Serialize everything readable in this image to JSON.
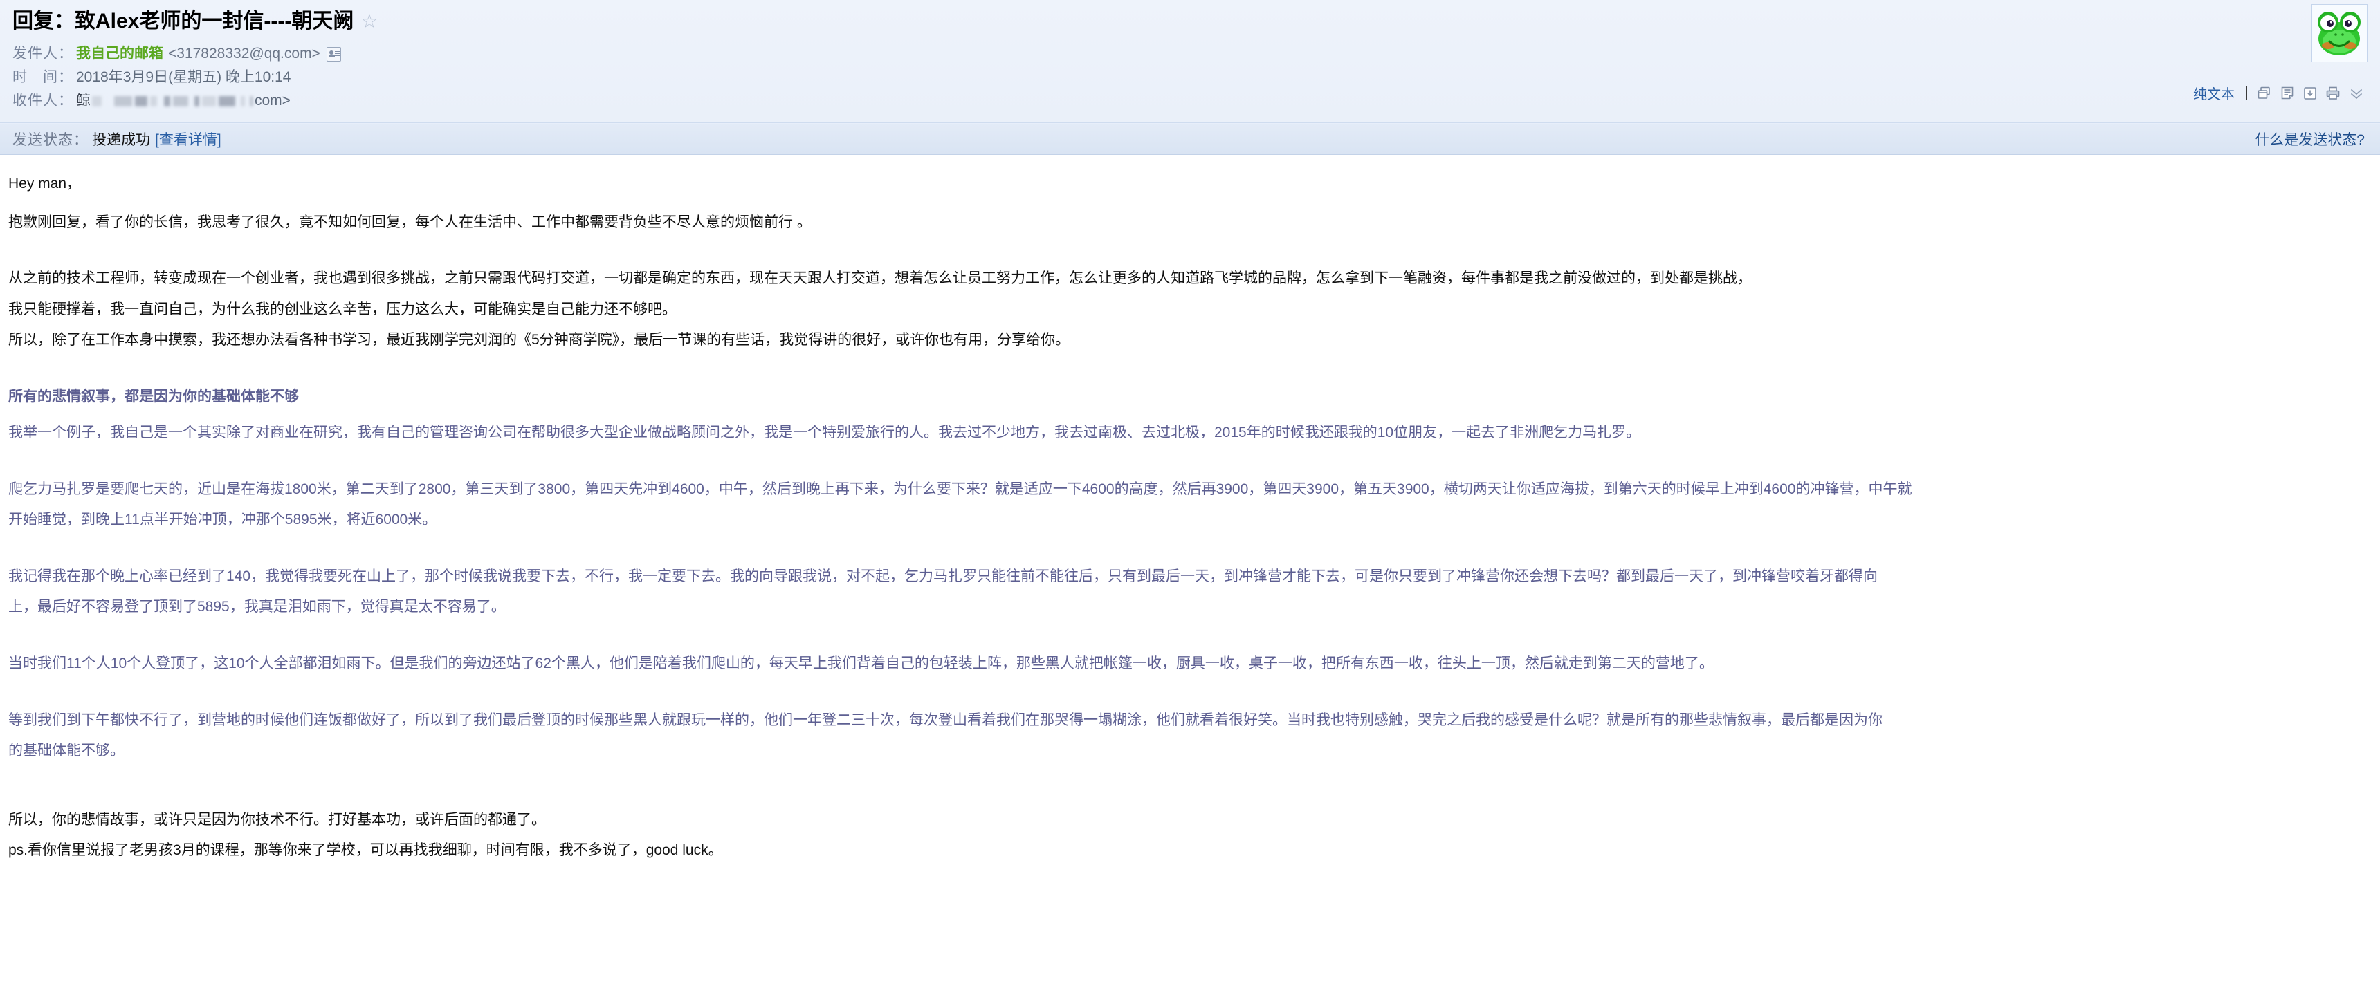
{
  "header": {
    "subject": "回复：致Alex老师的一封信----朝天阙",
    "star_icon": "star-outline-icon",
    "sender_label": "发件人：",
    "sender_name": "我自己的邮箱",
    "sender_address": "<317828332@qq.com>",
    "contact_card_icon": "contact-card-icon",
    "time_label": "时　间：",
    "time_value": "2018年3月9日(星期五) 晚上10:14",
    "recipient_label": "收件人：",
    "recipient_name": "鲸",
    "recipient_address_tail": "com>",
    "avatar_icon": "frog-avatar-icon"
  },
  "toolbar": {
    "plaintext_label": "纯文本",
    "icons": [
      {
        "name": "new-window-icon"
      },
      {
        "name": "note-edit-icon"
      },
      {
        "name": "save-download-icon"
      },
      {
        "name": "print-icon"
      },
      {
        "name": "chevron-double-down-icon"
      }
    ]
  },
  "status": {
    "label": "发送状态：",
    "value": "投递成功",
    "detail_link": "[查看详情]",
    "help_link": "什么是发送状态?"
  },
  "body": {
    "greeting": "Hey man，",
    "p1": "抱歉刚回复，看了你的长信，我思考了很久，竟不知如何回复，每个人在生活中、工作中都需要背负些不尽人意的烦恼前行 。",
    "p2": "从之前的技术工程师，转变成现在一个创业者，我也遇到很多挑战，之前只需跟代码打交道，一切都是确定的东西，现在天天跟人打交道，想着怎么让员工努力工作，怎么让更多的人知道路飞学城的品牌，怎么拿到下一笔融资，每件事都是我之前没做过的，到处都是挑战，",
    "p3": "我只能硬撑着，我一直问自己，为什么我的创业这么辛苦，压力这么大，可能确实是自己能力还不够吧。",
    "p4": "所以，除了在工作本身中摸索，我还想办法看各种书学习，最近我刚学完刘润的《5分钟商学院》，最后一节课的有些话，我觉得讲的很好，或许你也有用，分享给你。",
    "heading": "所有的悲情叙事，都是因为你的基础体能不够",
    "p5": "我举一个例子，我自己是一个其实除了对商业在研究，我有自己的管理咨询公司在帮助很多大型企业做战略顾问之外，我是一个特别爱旅行的人。我去过不少地方，我去过南极、去过北极，2015年的时候我还跟我的10位朋友，一起去了非洲爬乞力马扎罗。",
    "p6": "爬乞力马扎罗是要爬七天的，近山是在海拔1800米，第二天到了2800，第三天到了3800，第四天先冲到4600，中午，然后到晚上再下来，为什么要下来？就是适应一下4600的高度，然后再3900，第四天3900，第五天3900，横切两天让你适应海拔，到第六天的时候早上冲到4600的冲锋营，中午就",
    "p7": "开始睡觉，到晚上11点半开始冲顶，冲那个5895米，将近6000米。",
    "p8": "我记得我在那个晚上心率已经到了140，我觉得我要死在山上了，那个时候我说我要下去，不行，我一定要下去。我的向导跟我说，对不起，乞力马扎罗只能往前不能往后，只有到最后一天，到冲锋营才能下去，可是你只要到了冲锋营你还会想下去吗？都到最后一天了，到冲锋营咬着牙都得向",
    "p9": "上，最后好不容易登了顶到了5895，我真是泪如雨下，觉得真是太不容易了。",
    "p10": "当时我们11个人10个人登顶了，这10个人全部都泪如雨下。但是我们的旁边还站了62个黑人，他们是陪着我们爬山的，每天早上我们背着自己的包轻装上阵，那些黑人就把帐篷一收，厨具一收，桌子一收，把所有东西一收，往头上一顶，然后就走到第二天的营地了。",
    "p11": "等到我们到下午都快不行了，到营地的时候他们连饭都做好了，所以到了我们最后登顶的时候那些黑人就跟玩一样的，他们一年登二三十次，每次登山看着我们在那哭得一塌糊涂，他们就看着很好笑。当时我也特别感触，哭完之后我的感受是什么呢？就是所有的那些悲情叙事，最后都是因为你",
    "p12": "的基础体能不够。",
    "p13": "所以，你的悲情故事，或许只是因为你技术不行。打好基本功，或许后面的都通了。",
    "p14": "ps.看你信里说报了老男孩3月的课程，那等你来了学校，可以再找我细聊，时间有限，我不多说了，good luck。"
  },
  "colors": {
    "header_bg": "#eaf0f9",
    "status_bg": "#dde7f5",
    "sender_green": "#5aa81f",
    "link_blue": "#2a5fa5",
    "quote_purple": "#5d5f92"
  }
}
